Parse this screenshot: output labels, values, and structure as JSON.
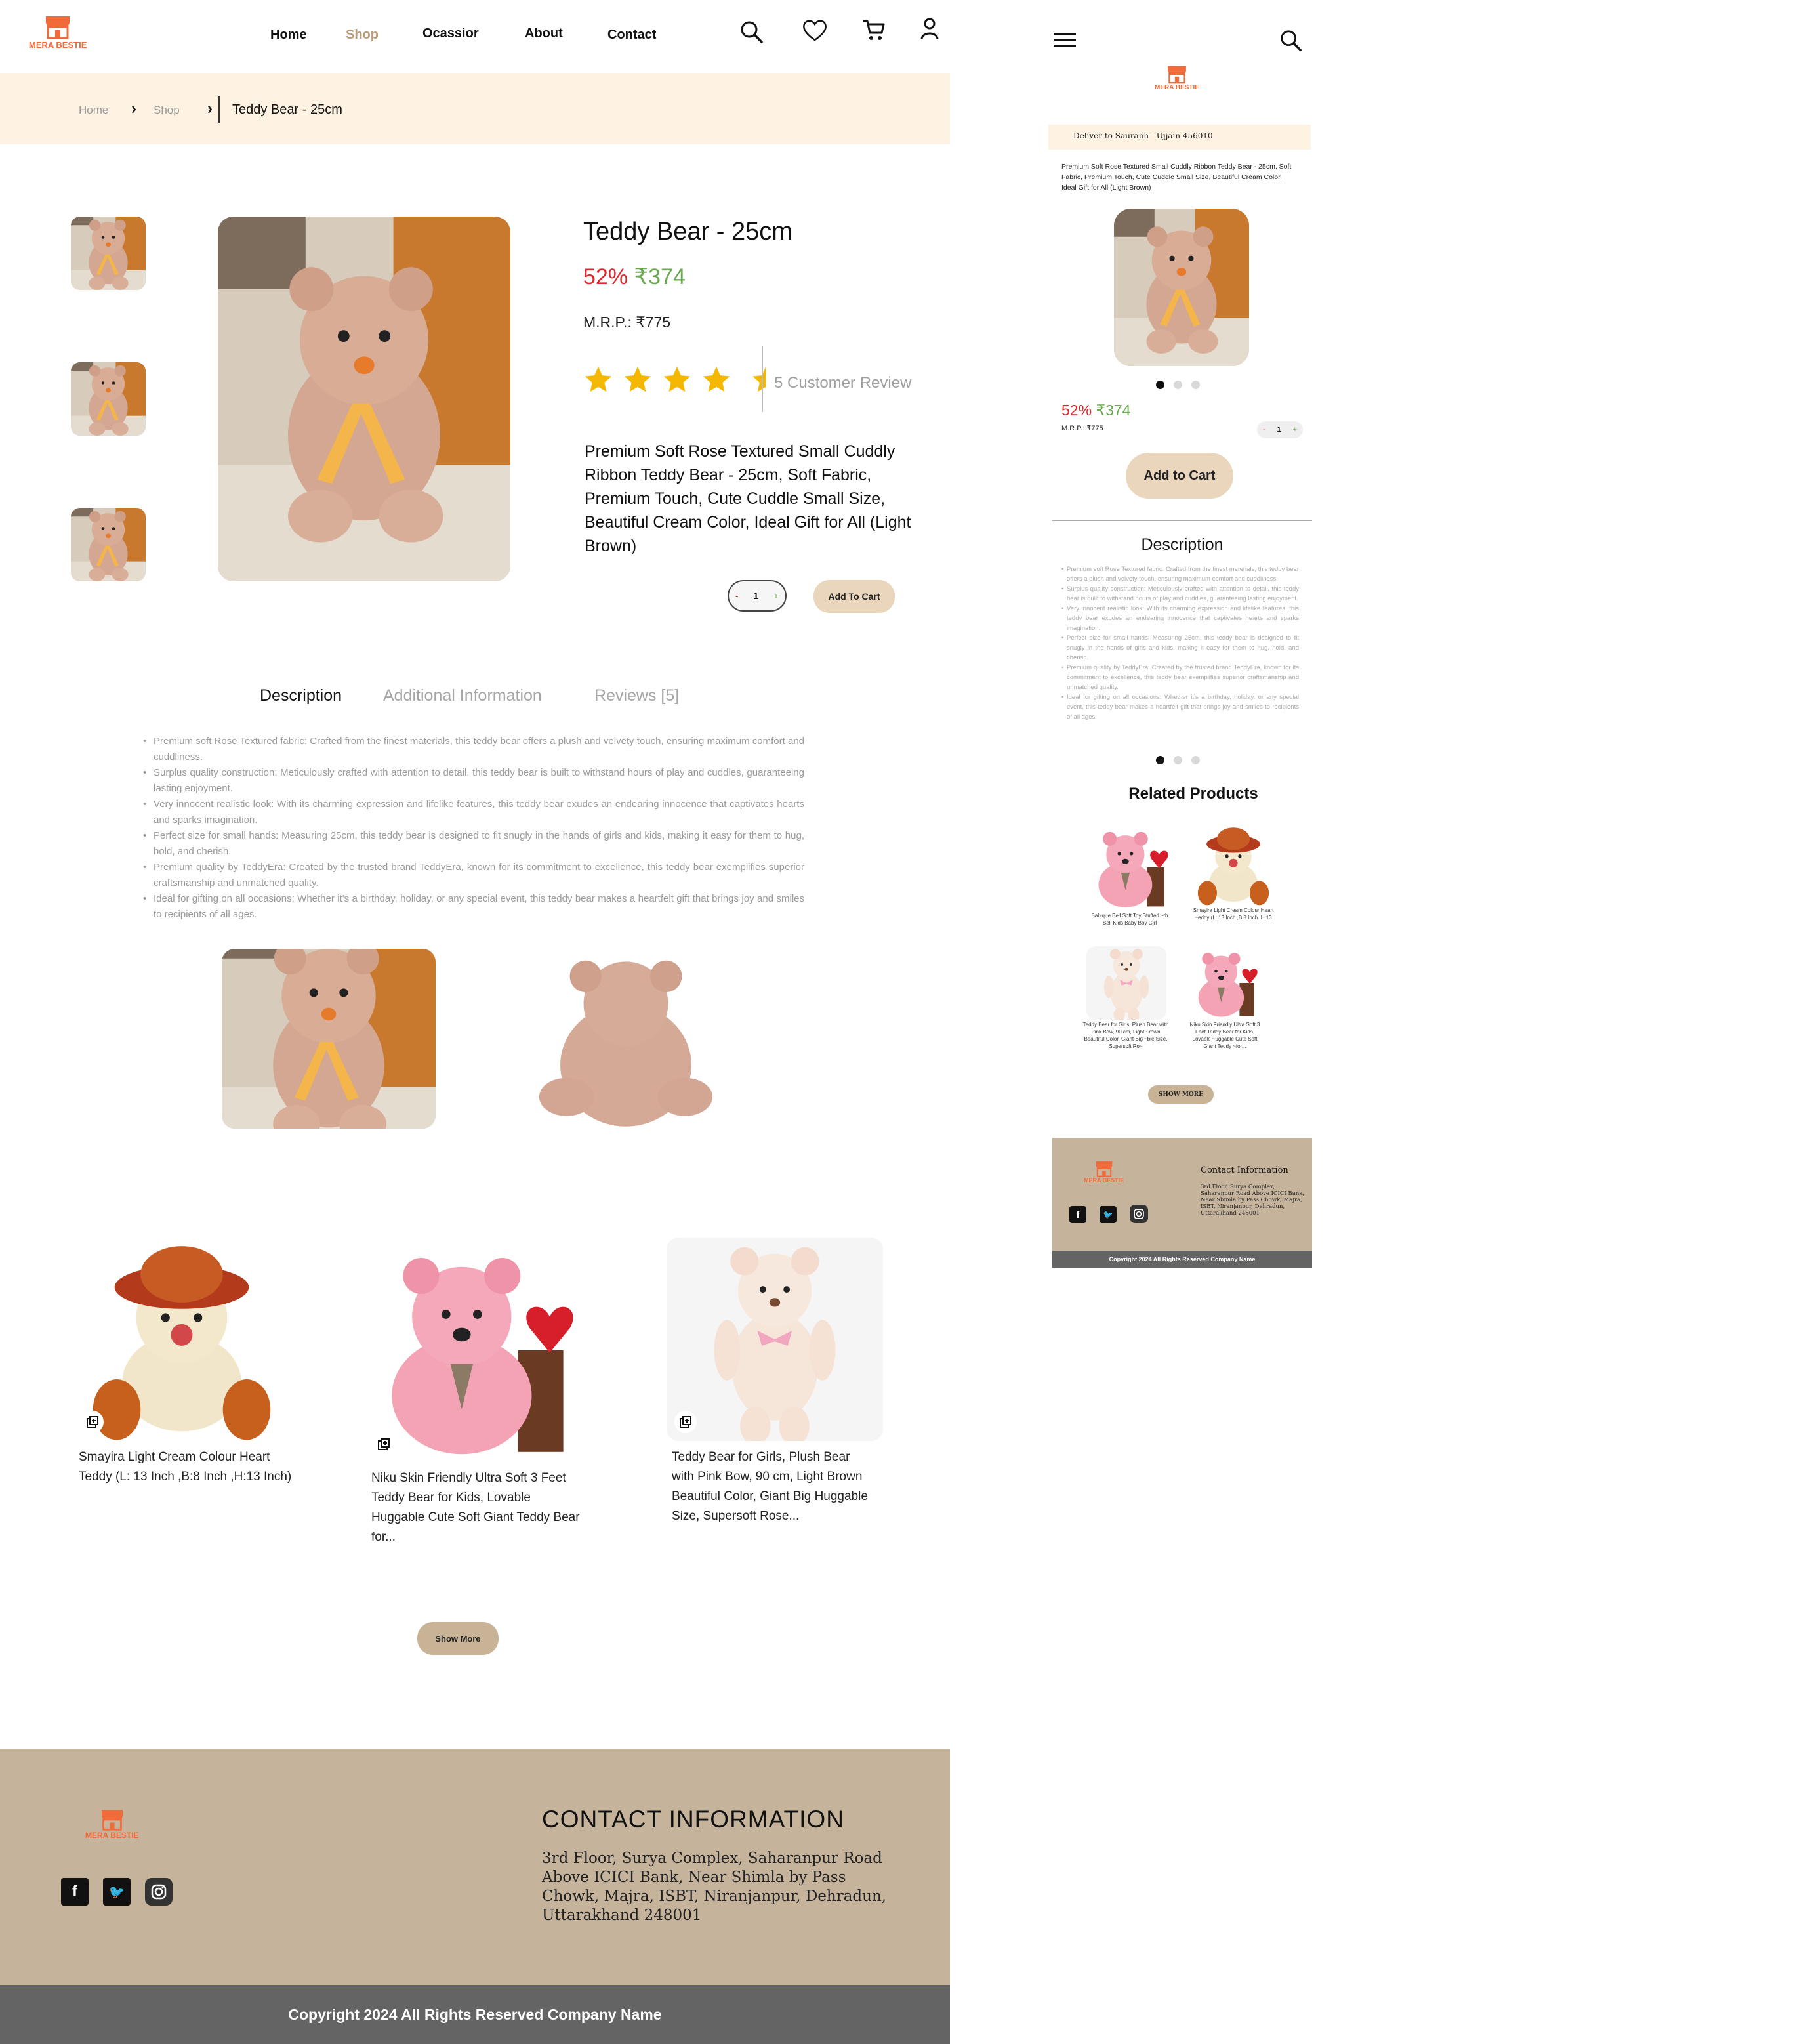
{
  "brand": {
    "name": "MERA BESTIE",
    "color": "#f06a3a"
  },
  "nav": {
    "home": "Home",
    "shop": "Shop",
    "occasion": "Ocassior",
    "about": "About",
    "contact": "Contact"
  },
  "icons": [
    "search-icon",
    "heart-icon",
    "cart-icon",
    "user-icon",
    "menu-icon"
  ],
  "breadcrumb": {
    "home": "Home",
    "shop": "Shop",
    "current": "Teddy Bear - 25cm"
  },
  "product": {
    "title": "Teddy Bear - 25cm",
    "discount": "52%",
    "price": "₹374",
    "mrp": "M.R.P.: ₹775",
    "rating": 4.5,
    "review_text": "5 Customer Review",
    "summary": "Premium Soft Rose Textured Small Cuddly Ribbon Teddy Bear - 25cm, Soft Fabric, Premium Touch, Cute Cuddle Small Size, Beautiful Cream Color, Ideal Gift for All (Light Brown)",
    "qty": "1",
    "qty_minus": "-",
    "qty_plus": "+",
    "add_to_cart": "Add To Cart"
  },
  "tabs": {
    "description": "Description",
    "additional": "Additional Information",
    "reviews": "Reviews [5]"
  },
  "description_points": [
    "Premium soft Rose Textured fabric: Crafted from the finest materials, this teddy bear offers a plush and velvety touch, ensuring maximum comfort and cuddliness.",
    "Surplus quality construction: Meticulously crafted with attention to detail, this teddy bear is built to withstand hours of play and cuddles, guaranteeing lasting enjoyment.",
    "Very innocent realistic look: With its charming expression and lifelike features, this teddy bear exudes an endearing innocence that captivates hearts and sparks imagination.",
    "Perfect size for small hands: Measuring 25cm, this teddy bear is designed to fit snugly in the hands of girls and kids, making it easy for them to hug, hold, and cherish.",
    "Premium quality by TeddyEra: Created by the trusted brand TeddyEra, known for its commitment to excellence, this teddy bear exemplifies superior craftsmanship and unmatched quality.",
    "Ideal for gifting on all occasions: Whether it's a birthday, holiday, or any special event, this teddy bear makes a heartfelt gift that brings joy and smiles to recipients of all ages."
  ],
  "related": [
    {
      "title": "Smayira Light Cream Colour Heart Teddy (L: 13 Inch ,B:8 Inch ,H:13 Inch)"
    },
    {
      "title": "Niku Skin Friendly Ultra Soft 3 Feet Teddy Bear for Kids, Lovable Huggable Cute Soft Giant Teddy Bear for..."
    },
    {
      "title": "Teddy Bear for Girls, Plush Bear with Pink Bow, 90 cm, Light Brown Beautiful Color, Giant Big Huggable Size, Supersoft Rose..."
    }
  ],
  "show_more": "Show More",
  "footer": {
    "contact_heading": "CONTACT INFORMATION",
    "address": "3rd Floor, Surya Complex, Saharanpur Road Above ICICI Bank, Near Shimla by Pass Chowk, Majra, ISBT, Niranjanpur, Dehradun, Uttarakhand 248001",
    "copyright": "Copyright 2024 All Rights Reserved Company Name"
  },
  "mobile": {
    "deliver": "Deliver to Saurabh - Ujjain 456010",
    "summary": "Premium Soft Rose Textured Small Cuddly Ribbon Teddy Bear - 25cm, Soft Fabric, Premium Touch, Cute Cuddle Small Size, Beautiful Cream Color, Ideal Gift for All (Light Brown)",
    "discount": "52%",
    "price": "₹374",
    "mrp": "M.R.P.: ₹775",
    "qty": "1",
    "add_to_cart": "Add to Cart",
    "description_heading": "Description",
    "related_heading": "Related Products",
    "related": [
      {
        "title": "Babique Bell Soft Toy Stuffed ~th Bell Kids Baby Boy Girl"
      },
      {
        "title": "Smayira Light Cream Colour Heart ~eddy (L: 13 Inch ,B:8 Inch ,H:13"
      },
      {
        "title": "Teddy Bear for Girls, Plush Bear with Pink Bow, 90 cm, Light ~rown Beautiful Color, Giant Big ~ble Size, Supersoft Ro~"
      },
      {
        "title": "Niku Skin Friendly Ultra Soft 3 Feet Teddy Bear for Kids, Lovable ~uggable Cute Soft Giant Teddy ~for..."
      }
    ],
    "show_more": "SHOW MORE",
    "contact_heading": "Contact Information",
    "address": "3rd Floor, Surya Complex, Saharanpur Road Above ICICI Bank, Near Shimla by Pass Chowk, Majra, ISBT, Niranjanpur, Dehradun, Uttarakhand 248001",
    "copyright": "Copyright 2024 All Rights Reserved Company Name"
  },
  "colors": {
    "discount": "#e0252b",
    "price": "#6aa84f",
    "star": "#f5b800",
    "tan": "#e9d6bc",
    "footer": "#c5b39b"
  }
}
